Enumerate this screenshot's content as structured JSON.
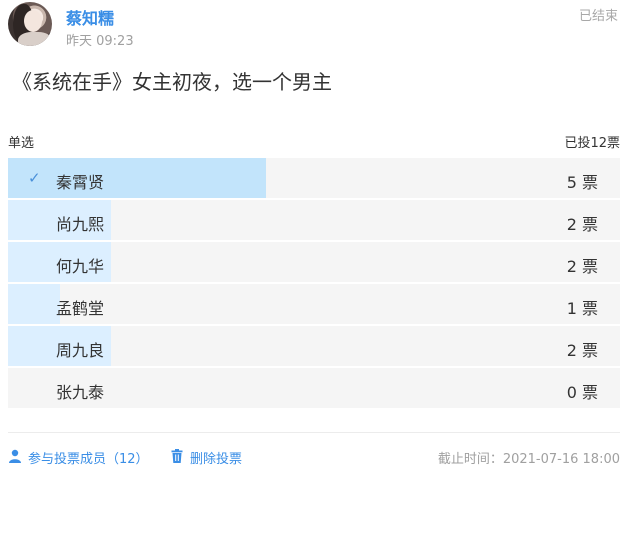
{
  "header": {
    "author": "蔡知糯",
    "time": "昨天 09:23",
    "status": "已结束"
  },
  "poll": {
    "title": "《系统在手》女主初夜，选一个男主",
    "type_label": "单选",
    "total_label": "已投12票",
    "total_votes": 12,
    "options": [
      {
        "name": "秦霄贤",
        "count_label": "5 票",
        "votes": 5,
        "selected": true
      },
      {
        "name": "尚九熙",
        "count_label": "2 票",
        "votes": 2,
        "selected": false
      },
      {
        "name": "何九华",
        "count_label": "2 票",
        "votes": 2,
        "selected": false
      },
      {
        "name": "孟鹤堂",
        "count_label": "1 票",
        "votes": 1,
        "selected": false
      },
      {
        "name": "周九良",
        "count_label": "2 票",
        "votes": 2,
        "selected": false
      },
      {
        "name": "张九泰",
        "count_label": "0 票",
        "votes": 0,
        "selected": false
      }
    ]
  },
  "footer": {
    "members_label": "参与投票成员（12）",
    "delete_label": "删除投票",
    "deadline_label": "截止时间：2021-07-16 18:00"
  },
  "icons": {
    "check": "checkmark-icon",
    "person": "person-icon",
    "trash": "trash-icon"
  },
  "colors": {
    "accent": "#3a8ee6",
    "selected_fill": "#c2e4fb",
    "vote_fill": "#dcefff"
  }
}
